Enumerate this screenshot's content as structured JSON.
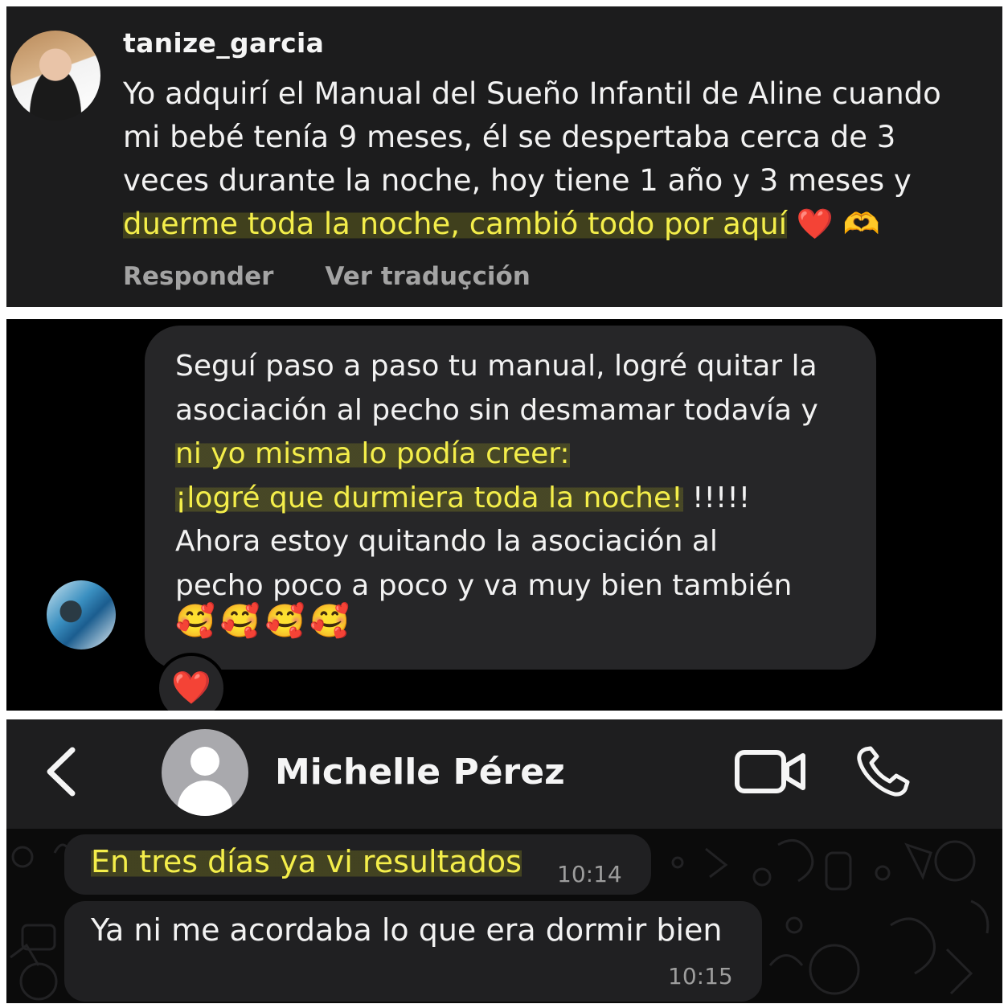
{
  "comment_panel": {
    "username": "tanize_garcia",
    "text_plain": "Yo adquirí el Manual del Sueño Infantil de Aline cuando mi bebé tenía 9 meses, él se despertaba cerca de 3 veces durante la noche, hoy tiene 1 año y 3 meses y",
    "text_highlight": "duerme toda la noche, cambió todo por aquí",
    "emoji": "❤️ 🫶",
    "reply_label": "Responder",
    "translate_label": "Ver traduçción"
  },
  "dm_panel": {
    "line1": "Seguí paso a paso tu manual, logré quitar la",
    "line2": "asociación al pecho sin desmamar todavía y",
    "highlight1": "ni yo misma lo podía creer:",
    "highlight2": "¡logré que durmiera toda la noche!",
    "exclaim": " !!!!!",
    "line5": "Ahora estoy quitando la asociación al",
    "line6": "pecho poco a poco y va muy bien también",
    "emojis": "🥰🥰🥰🥰",
    "reaction": "❤️"
  },
  "whatsapp_panel": {
    "contact_name": "Michelle Pérez",
    "icons": [
      "back-chevron-icon",
      "video-call-icon",
      "phone-icon"
    ],
    "messages": [
      {
        "text": "En tres días ya vi resultados",
        "time": "10:14"
      },
      {
        "text": "Ya ni me acordaba lo que era dormir bien",
        "time": "10:15"
      }
    ]
  },
  "colors": {
    "highlight_text": "#f4ee4a",
    "panel_dark": "#1c1c1d",
    "bubble": "#262628",
    "wa_bubble": "#202022"
  }
}
